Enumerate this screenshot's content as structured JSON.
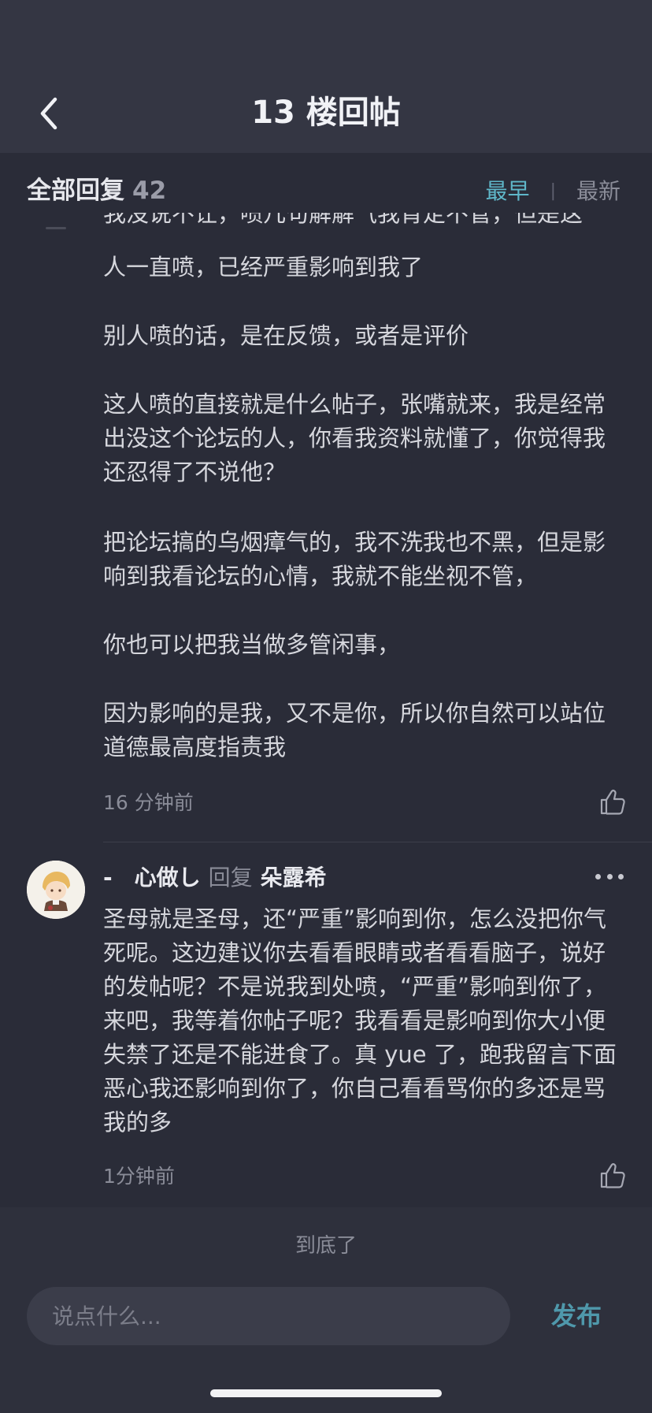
{
  "header": {
    "title": "13 楼回帖"
  },
  "subbar": {
    "label": "全部回复",
    "count": "42",
    "sort_earliest": "最早",
    "sort_latest": "最新"
  },
  "post": {
    "partial_line": "我没说不让，喷几句解解气我肯定不管，但是这",
    "paragraphs": [
      "人一直喷，已经严重影响到我了",
      "别人喷的话，是在反馈，或者是评价",
      "这人喷的直接就是什么帖子，张嘴就来，我是经常出没这个论坛的人，你看我资料就懂了，你觉得我还忍得了不说他？",
      "把论坛搞的乌烟瘴气的，我不洗我也不黑，但是影响到我看论坛的心情，我就不能坐视不管，",
      "你也可以把我当做多管闲事，",
      "因为影响的是我，又不是你，所以你自然可以站位道德最高度指责我"
    ],
    "time": "16 分钟前"
  },
  "reply": {
    "name": "-　心做し",
    "reply_word": "回复",
    "target": "朵露希",
    "text": "圣母就是圣母，还“严重”影响到你，怎么没把你气死呢。这边建议你去看看眼睛或者看看脑子，说好的发帖呢？不是说我到处喷，“严重”影响到你了，来吧，我等着你帖子呢？我看看是影响到你大小便失禁了还是不能进食了。真 yue 了，跑我留言下面恶心我还影响到你了，你自己看看骂你的多还是骂我的多",
    "time": "1分钟前"
  },
  "footer": {
    "end_text": "到底了",
    "input_placeholder": "说点什么...",
    "publish_label": "发布"
  },
  "colors": {
    "background": "#2a2c38",
    "header": "#343643",
    "accent": "#5fb7c9",
    "publish": "#4f98ab"
  }
}
